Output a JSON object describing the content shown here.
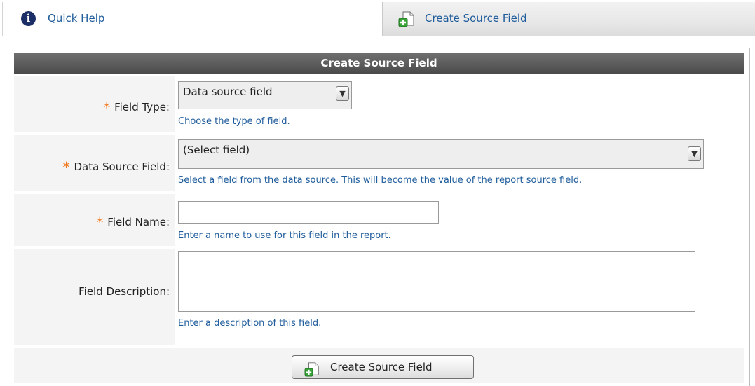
{
  "tabs": {
    "quick_help": "Quick Help",
    "create_source_field": "Create Source Field"
  },
  "form": {
    "title": "Create Source Field",
    "required_mark": "*",
    "field_type": {
      "label": "Field Type:",
      "value": "Data source field",
      "hint": "Choose the type of field."
    },
    "data_source_field": {
      "label": "Data Source Field:",
      "value": "(Select field)",
      "hint": "Select a field from the data source. This will become the value of the report source field."
    },
    "field_name": {
      "label": "Field Name:",
      "value": "",
      "hint": "Enter a name to use for this field in the report."
    },
    "field_description": {
      "label": "Field Description:",
      "value": "",
      "hint": "Enter a description of this field."
    },
    "submit_label": "Create Source Field"
  },
  "colors": {
    "link_blue": "#1f5c9c",
    "required_orange": "#f07a20",
    "header_gray": "#5e5e5e"
  },
  "icons": {
    "help": "info-icon",
    "create": "document-add-icon",
    "dropdown": "chevron-down-icon"
  }
}
